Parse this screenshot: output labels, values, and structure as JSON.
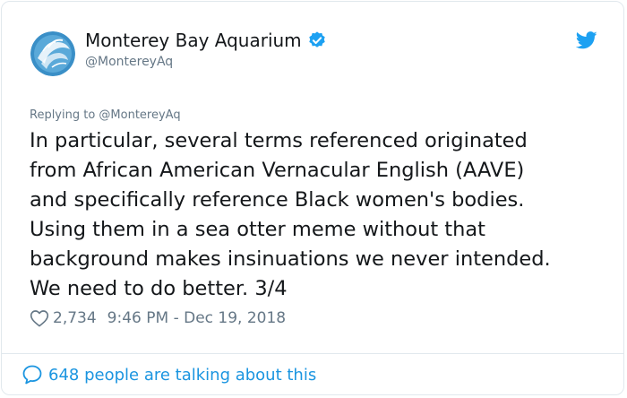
{
  "author": {
    "name": "Monterey Bay Aquarium",
    "handle": "@MontereyAq",
    "verified": true,
    "avatar_icon": "monterey-bay-aquarium-logo"
  },
  "platform_icon": "twitter-bird-icon",
  "replying_to": "Replying to @MontereyAq",
  "tweet_text": "In particular, several terms referenced originated\nfrom African American Vernacular English (AAVE)\nand specifically reference Black women's bodies.\nUsing them in a sea otter meme without that\nbackground makes insinuations we never intended.\nWe need to do better. 3/4",
  "likes": "2,734",
  "timestamp": "9:46 PM - Dec 19, 2018",
  "talking": "648 people are talking about this",
  "colors": {
    "brand_blue": "#1da1f2",
    "link_blue": "#1b95e0",
    "text": "#14171a",
    "muted": "#657786",
    "border": "#e1e8ed"
  }
}
